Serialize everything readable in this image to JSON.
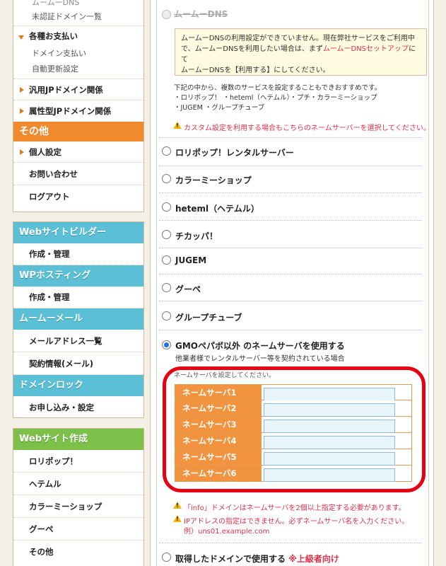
{
  "sidebar": {
    "top_partial": "ムームーDNS",
    "unverified_domains": "未認証ドメイン一覧",
    "payments": "各種お支払い",
    "domain_payment": "ドメイン支払い",
    "auto_renew": "自動更新設定",
    "generic_jp": "汎用JPドメイン関係",
    "attribute_jp": "属性型JPドメイン関係",
    "other_header": "その他",
    "personal_settings": "個人設定",
    "contact": "お問い合わせ",
    "logout": "ログアウト",
    "website_builder": "Webサイトビルダー",
    "builder_manage": "作成・管理",
    "wp_hosting": "WPホスティング",
    "wp_manage": "作成・管理",
    "mumu_mail": "ムームーメール",
    "mail_list": "メールアドレス一覧",
    "mail_contract": "契約情報(メール)",
    "domain_lock": "ドメインロック",
    "lock_apply": "お申し込み・設定",
    "website_create": "Webサイト作成",
    "lolipop": "ロリポップ！",
    "hetemuru": "ヘテムル",
    "colorme": "カラーミーショップ",
    "goope": "グーペ",
    "other": "その他"
  },
  "main": {
    "mumu_dns_title": "ムームーDNS",
    "notice_lines": [
      "ムームーDNSの利用設定ができていません。現在弊社サービスをご利用中",
      "で、ムームーDNSを利用したい場合は、まず",
      "ムームーDNSセットアップ",
      "にて",
      "ムームーDNSを【利用する】にしてください。"
    ],
    "info_lines": [
      "下記の中から、複数のサービスを設定することもできおすすめです。",
      "・ロリポップ！ ・heteml（ヘテムル）・プチ・カラーミーショップ",
      "・JUGEM ・グループチューブ"
    ],
    "custom_warn": "カスタム設定を利用する場合もこちらのネームサーバーを選択してください。",
    "options": [
      "ロリポップ！レンタルサーバー",
      "カラーミーショップ",
      "heteml（ヘテムル）",
      "チカッパ！",
      "JUGEM",
      "グーペ",
      "グループチューブ",
      "GMOペパボ以外 のネームサーバを使用する"
    ],
    "gmo_desc": "他業者様でレンタルサーバー等を契約されている場合",
    "ns_hint": "ネームサーバを設定してください。",
    "ns_labels": [
      "ネームサーバ1",
      "ネームサーバ2",
      "ネームサーバ3",
      "ネームサーバ4",
      "ネームサーバ5",
      "ネームサーバ6"
    ],
    "ns_values": [
      "",
      "",
      "",
      "",
      "",
      ""
    ],
    "warn_info": "「info」ドメインはネームサーバを2個以上指定する必要があります。",
    "warn_ip": "IPアドレスの指定はできません。必ずネームサーバ名を入力ください。",
    "warn_example": "例）uns01.example.com",
    "bottom_option": "取得したドメインで使用する",
    "bottom_advanced": "※上級者向け"
  }
}
